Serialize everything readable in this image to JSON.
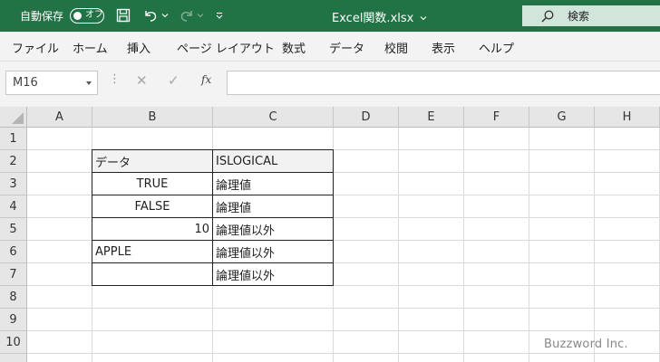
{
  "titlebar": {
    "autosave_label": "自動保存",
    "autosave_state": "オフ",
    "file_title": "Excel関数.xlsx",
    "search_placeholder": "検索",
    "color": "#217346"
  },
  "ribbon": {
    "tabs": [
      "ファイル",
      "ホーム",
      "挿入",
      "ページ レイアウト",
      "数式",
      "データ",
      "校閲",
      "表示",
      "ヘルプ"
    ]
  },
  "formula_bar": {
    "name_box": "M16",
    "fx_label": "fx",
    "formula": ""
  },
  "sheet": {
    "columns": [
      "A",
      "B",
      "C",
      "D",
      "E",
      "F",
      "G",
      "H"
    ],
    "rows": [
      "1",
      "2",
      "3",
      "4",
      "5",
      "6",
      "7",
      "8",
      "9",
      "10"
    ],
    "cells": {
      "B2": "データ",
      "C2": "ISLOGICAL",
      "B3": "TRUE",
      "C3": "論理値",
      "B4": "FALSE",
      "C4": "論理値",
      "B5": "10",
      "C5": "論理値以外",
      "B6": "APPLE",
      "C6": "論理値以外",
      "B7": "",
      "C7": "論理値以外"
    },
    "header_fill": "#f2f2f2"
  },
  "watermark": "Buzzword Inc."
}
